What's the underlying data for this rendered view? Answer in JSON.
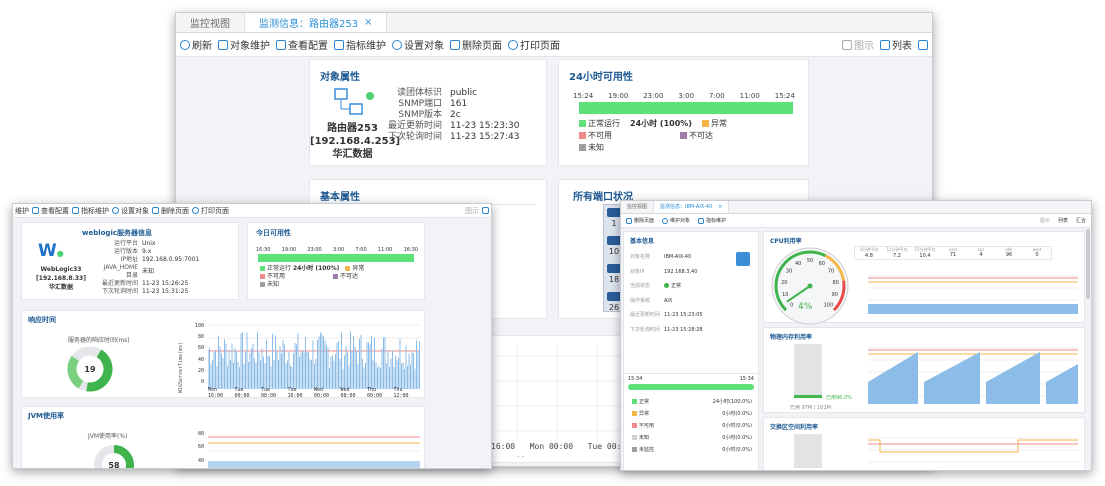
{
  "w1": {
    "tab1": "监控视图",
    "tab2": "监测信息：路由器253",
    "toolbar": [
      "刷新",
      "对象维护",
      "查看配置",
      "指标维护",
      "设置对象",
      "删除页面",
      "打印页面"
    ],
    "tr1": "图示",
    "tr2": "列表",
    "obj": {
      "title": "对象属性",
      "name": "路由器253",
      "ip": "[192.168.4.253]",
      "group": "华汇数据",
      "fields": [
        [
          "读团体标识",
          "public"
        ],
        [
          "SNMP端口",
          "161"
        ],
        [
          "SNMP版本",
          "2c"
        ],
        [
          "最近更新时间",
          "11-23 15:23:30"
        ],
        [
          "下次轮询时间",
          "11-23 15:27:43"
        ]
      ]
    },
    "avail": {
      "title": "24小时可用性",
      "ticks": [
        "15:24",
        "19:00",
        "23:00",
        "3:00",
        "7:00",
        "11:00",
        "15:24"
      ],
      "legend": [
        {
          "label": "正常运行",
          "value": "24小时 (100%)",
          "color": "#5ee07a"
        },
        {
          "label": "异常",
          "color": "#f5b648"
        },
        {
          "label": "不可用",
          "color": "#f08a8a"
        },
        {
          "label": "不可达",
          "color": "#a07aa8"
        },
        {
          "label": "未知",
          "color": "#9e9e9e"
        }
      ]
    },
    "basic": {
      "title": "基本属性"
    },
    "ports": {
      "title": "所有端口状况",
      "nums": [
        "1",
        "10",
        "18",
        "26"
      ]
    },
    "chart_ticks": [
      "16:00",
      "Mon 00:00",
      "Tue 00:00"
    ],
    "dash": "- -"
  },
  "w2": {
    "toolbar": [
      "维护",
      "查看配置",
      "指标维护",
      "设置对象",
      "删除页面",
      "打印页面"
    ],
    "tr": "图示",
    "obj": {
      "title": "weblogic服务器信息",
      "name": "WebLogic33",
      "ip": "[192.168.8.33]",
      "group": "华汇数据",
      "fields": [
        [
          "运行平台",
          "Unix"
        ],
        [
          "运行版本",
          "9.x"
        ],
        [
          "IP地址",
          "192.168.0.95:7001"
        ],
        [
          "JAVA_HOME目录",
          "未知"
        ],
        [
          "最近更新时间",
          "11-23 15:26:25"
        ],
        [
          "下次轮询时间",
          "11-23 15:31:25"
        ]
      ]
    },
    "avail": {
      "title": "今日可用性",
      "ticks": [
        "16:30",
        "19:00",
        "23:00",
        "3:00",
        "7:00",
        "11:00",
        "16:30"
      ],
      "legend": [
        {
          "label": "正常运行",
          "value": "24小时 (100%)",
          "color": "#5ee07a"
        },
        {
          "label": "异常",
          "color": "#f5b648"
        },
        {
          "label": "不可用",
          "color": "#f08a8a"
        },
        {
          "label": "不可达",
          "color": "#a07aa8"
        },
        {
          "label": "未知",
          "color": "#9e9e9e"
        }
      ]
    },
    "resp": {
      "title": "响应时间",
      "gauge_label": "服务器的响应时间(ms)",
      "gauge_value": "19",
      "ylabel": "W1GServerTime(ms)",
      "yticks": [
        "100",
        "80",
        "60",
        "40",
        "20",
        "0"
      ],
      "xticks": [
        "Mon 16:00",
        "Tue 00:00",
        "Tue 08:00",
        "Tue 16:00",
        "Wed 00:00",
        "Wed 08:00",
        "Thu 00:00",
        "Thu 12:00"
      ]
    },
    "jvm": {
      "title": "JVM使用率",
      "gauge_label": "JVM使用率(%)",
      "gauge_value": "58",
      "yticks": [
        "80",
        "60",
        "40",
        "20"
      ]
    }
  },
  "w3": {
    "tab1": "监控视图",
    "tab2": "监测信息：IBM-AIX-40",
    "toolbar": [
      "删除页面",
      "维护对象",
      "指标维护"
    ],
    "tr": [
      "图示",
      "列表",
      "汇合"
    ],
    "basic": {
      "title": "基本信息",
      "fields": [
        [
          "对象名称",
          "IBM-AIX-40"
        ],
        [
          "对象IP",
          "192.168.3.40"
        ],
        [
          "当前状态",
          "正常"
        ],
        [
          "操作系统",
          "AIX"
        ],
        [
          "最近更新时间",
          "11-23 15:23:05"
        ],
        [
          "下次轮询时间",
          "11-23 15:28:28"
        ]
      ]
    },
    "avail": {
      "t1": "15:34",
      "t2": "15:34",
      "rows": [
        [
          "正常",
          "24小时(100.0%)",
          "#5ee07a"
        ],
        [
          "异常",
          "0小时(0.0%)",
          "#f5b648"
        ],
        [
          "不可用",
          "0小时(0.0%)",
          "#f08a8a"
        ],
        [
          "未知",
          "0小时(0.0%)",
          "#d0d0d0"
        ],
        [
          "未监控",
          "0小时(0.0%)",
          "#9e9e9e"
        ]
      ]
    },
    "cpu": {
      "title": "CPU利用率",
      "value": "4%",
      "gauge_ticks": [
        "0",
        "10",
        "20",
        "30",
        "40",
        "50",
        "60",
        "70",
        "80",
        "90",
        "100"
      ],
      "stats": [
        [
          "5分钟平均",
          "4.8"
        ],
        [
          "15分钟平均",
          "7.2"
        ],
        [
          "15分钟平均",
          "10.4"
        ],
        [
          "user",
          "71"
        ],
        [
          "sys",
          "4"
        ],
        [
          "idle",
          "96"
        ],
        [
          "wait",
          "0"
        ]
      ]
    },
    "mem": {
      "title": "物理内存利用率",
      "value_label": "已用96.0%",
      "size": "已用 97M / 102M"
    },
    "swap": {
      "title": "交换区空间利用率"
    }
  }
}
